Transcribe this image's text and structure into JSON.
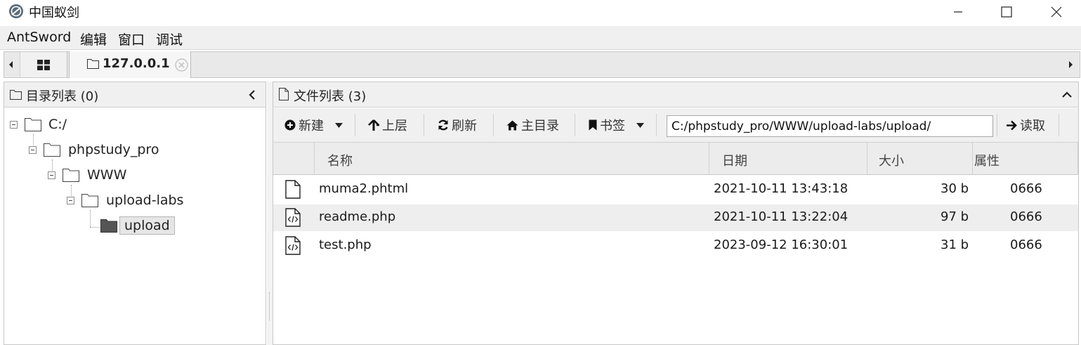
{
  "window": {
    "title": "中国蚁剑"
  },
  "menu": [
    "AntSword",
    "编辑",
    "窗口",
    "调试"
  ],
  "tabs": {
    "active_label": "127.0.0.1"
  },
  "dir_panel": {
    "title": "目录列表 (0)",
    "tree": [
      {
        "label": "C:/",
        "level": 0
      },
      {
        "label": "phpstudy_pro",
        "level": 1
      },
      {
        "label": "WWW",
        "level": 2
      },
      {
        "label": "upload-labs",
        "level": 3
      },
      {
        "label": "upload",
        "level": 4,
        "selected": true
      }
    ]
  },
  "file_panel": {
    "title": "文件列表 (3)",
    "toolbar": {
      "new_label": "新建",
      "up_label": "上层",
      "refresh_label": "刷新",
      "home_label": "主目录",
      "bookmark_label": "书签",
      "path_value": "C:/phpstudy_pro/WWW/upload-labs/upload/",
      "read_label": "读取"
    },
    "columns": [
      "名称",
      "日期",
      "大小",
      "属性"
    ],
    "files": [
      {
        "name": "muma2.phtml",
        "date": "2021-10-11 13:43:18",
        "size": "30 b",
        "attr": "0666",
        "icon": "file-icon"
      },
      {
        "name": "readme.php",
        "date": "2021-10-11 13:22:04",
        "size": "97 b",
        "attr": "0666",
        "icon": "code-file-icon"
      },
      {
        "name": "test.php",
        "date": "2023-09-12 16:30:01",
        "size": "31 b",
        "attr": "0666",
        "icon": "code-file-icon"
      }
    ]
  },
  "colors": {
    "menubar_bg": "#f0f0f0",
    "panel_header_bg": "#f0f0f0",
    "alt_row_bg": "#eeeeee",
    "selected_node_bg": "#e6e6e6"
  }
}
